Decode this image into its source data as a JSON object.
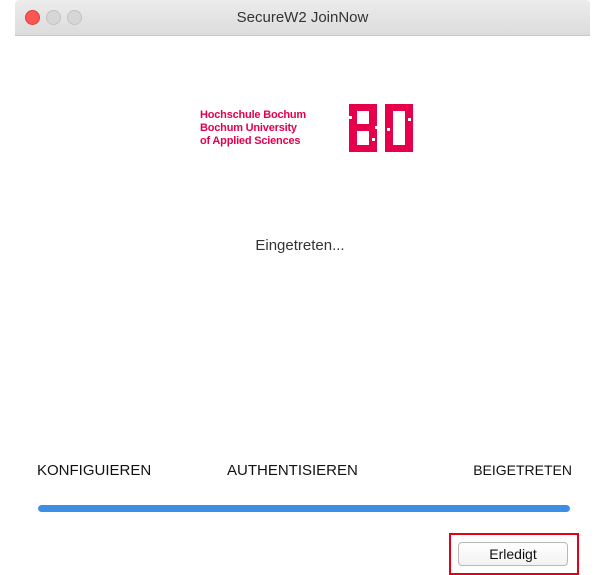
{
  "window": {
    "title": "SecureW2 JoinNow"
  },
  "logo": {
    "lines": [
      "Hochschule Bochum",
      "Bochum University",
      "of Applied Sciences"
    ],
    "mark_text": "BO",
    "color": "#e6004c"
  },
  "status": {
    "text": "Eingetreten..."
  },
  "steps": [
    {
      "label": "KONFIGUIEREN"
    },
    {
      "label": "AUTHENTISIEREN"
    },
    {
      "label": "BEIGETRETEN"
    }
  ],
  "progress": {
    "value": 1.0,
    "color": "#3d8ee5"
  },
  "buttons": {
    "done_label": "Erledigt"
  },
  "colors": {
    "highlight": "#e3001b",
    "close": "#fc5753"
  }
}
